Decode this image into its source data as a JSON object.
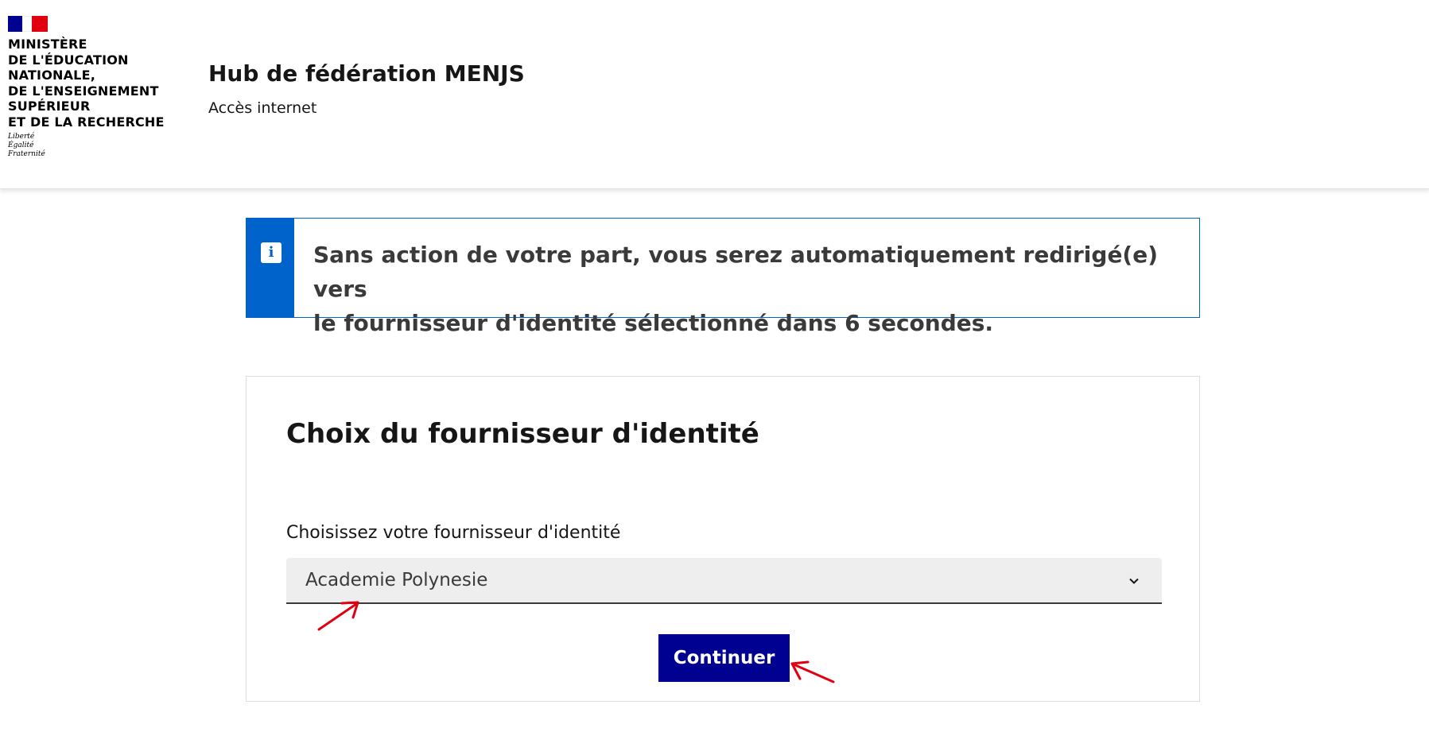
{
  "header": {
    "ministry_lines": [
      "Ministère",
      "de l'Éducation",
      "nationale,",
      "de l'Enseignement",
      "supérieur",
      "et de la Recherche"
    ],
    "motto": [
      "Liberté",
      "Égalité",
      "Fraternité"
    ],
    "service_title": "Hub de fédération MENJS",
    "service_tagline": "Accès internet"
  },
  "notice": {
    "icon": "info-icon",
    "line1": "Sans action de votre part, vous serez automatiquement redirigé(e) vers",
    "line2": "le fournisseur d'identité sélectionné dans 6 secondes."
  },
  "form": {
    "title": "Choix du fournisseur d'identité",
    "select_label": "Choisissez votre fournisseur d'identité",
    "select_value": "Academie Polynesie",
    "submit_label": "Continuer"
  },
  "colors": {
    "brand_blue": "#000091",
    "info_blue": "#0063cb",
    "annotation_red": "#e1000f"
  }
}
